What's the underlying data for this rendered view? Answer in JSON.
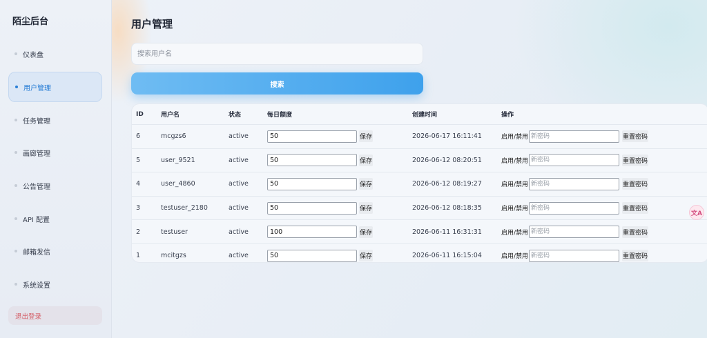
{
  "sidebar": {
    "brand": "陌尘后台",
    "items": [
      {
        "label": "仪表盘",
        "active": false
      },
      {
        "label": "用户管理",
        "active": true
      },
      {
        "label": "任务管理",
        "active": false
      },
      {
        "label": "画廊管理",
        "active": false
      },
      {
        "label": "公告管理",
        "active": false
      },
      {
        "label": "API 配置",
        "active": false
      },
      {
        "label": "邮箱发信",
        "active": false
      },
      {
        "label": "系统设置",
        "active": false
      }
    ],
    "logout_label": "退出登录"
  },
  "main": {
    "title": "用户管理",
    "search": {
      "placeholder": "搜索用户名",
      "value": "",
      "button_label": "搜索"
    },
    "table": {
      "headers": [
        "ID",
        "用户名",
        "状态",
        "每日额度",
        "创建时间",
        "操作"
      ],
      "save_label": "保存",
      "toggle_label": "启用/禁用",
      "password_placeholder": "新密码",
      "reset_label": "重置密码",
      "rows": [
        {
          "id": "6",
          "username": "mcgzs6",
          "status": "active",
          "quota": "50",
          "created": "2026-06-17 16:11:41"
        },
        {
          "id": "5",
          "username": "user_9521",
          "status": "active",
          "quota": "50",
          "created": "2026-06-12 08:20:51"
        },
        {
          "id": "4",
          "username": "user_4860",
          "status": "active",
          "quota": "50",
          "created": "2026-06-12 08:19:27"
        },
        {
          "id": "3",
          "username": "testuser_2180",
          "status": "active",
          "quota": "50",
          "created": "2026-06-12 08:18:35"
        },
        {
          "id": "2",
          "username": "testuser",
          "status": "active",
          "quota": "100",
          "created": "2026-06-11 16:31:31"
        },
        {
          "id": "1",
          "username": "mcitgzs",
          "status": "active",
          "quota": "50",
          "created": "2026-06-11 16:15:04"
        }
      ]
    }
  },
  "floating": {
    "translate_icon": "translate-icon",
    "glyph": "文A"
  },
  "colors": {
    "accent": "#3ea1ec",
    "logout": "#d45d66",
    "active_bg": "#dbe7f6"
  }
}
